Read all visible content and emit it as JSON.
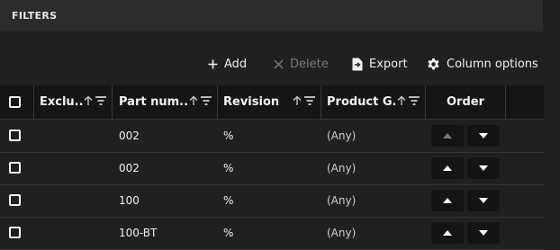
{
  "filters": {
    "title": "FILTERS"
  },
  "toolbar": {
    "add_label": "Add",
    "delete_label": "Delete",
    "export_label": "Export",
    "column_options_label": "Column options"
  },
  "table": {
    "columns": [
      "Exclu...",
      "Part num...",
      "Revision",
      "Product G...",
      "Order"
    ],
    "rows": [
      {
        "exclude": "",
        "part_number": "002",
        "revision": "%",
        "product_group": "(Any)",
        "move_up_enabled": false
      },
      {
        "exclude": "",
        "part_number": "002",
        "revision": "%",
        "product_group": "(Any)",
        "move_up_enabled": true
      },
      {
        "exclude": "",
        "part_number": "100",
        "revision": "%",
        "product_group": "(Any)",
        "move_up_enabled": true
      },
      {
        "exclude": "",
        "part_number": "100-BT",
        "revision": "%",
        "product_group": "(Any)",
        "move_up_enabled": true
      }
    ]
  }
}
